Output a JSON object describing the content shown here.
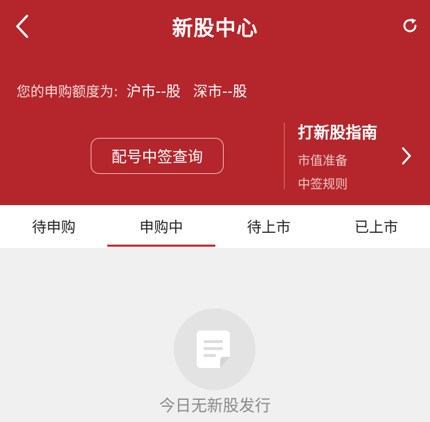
{
  "header": {
    "title": "新股中心",
    "back_icon": "chevron-left-icon",
    "refresh_icon": "refresh-icon"
  },
  "quota": {
    "label": "您的申购额度为:",
    "sh": "沪市--股",
    "sz": "深市--股"
  },
  "query_button": "配号中签查询",
  "guide": {
    "title": "打新股指南",
    "items": [
      "市值准备",
      "中签规则"
    ],
    "arrow_icon": "chevron-right-icon"
  },
  "tabs": [
    {
      "label": "待申购",
      "active": false
    },
    {
      "label": "申购中",
      "active": true
    },
    {
      "label": "待上市",
      "active": false
    },
    {
      "label": "已上市",
      "active": false
    }
  ],
  "empty": {
    "icon": "document-icon",
    "text": "今日无新股发行"
  },
  "colors": {
    "brand_red": "#b4262b",
    "tab_indicator": "#c8282e",
    "background": "#f0f0f0"
  }
}
